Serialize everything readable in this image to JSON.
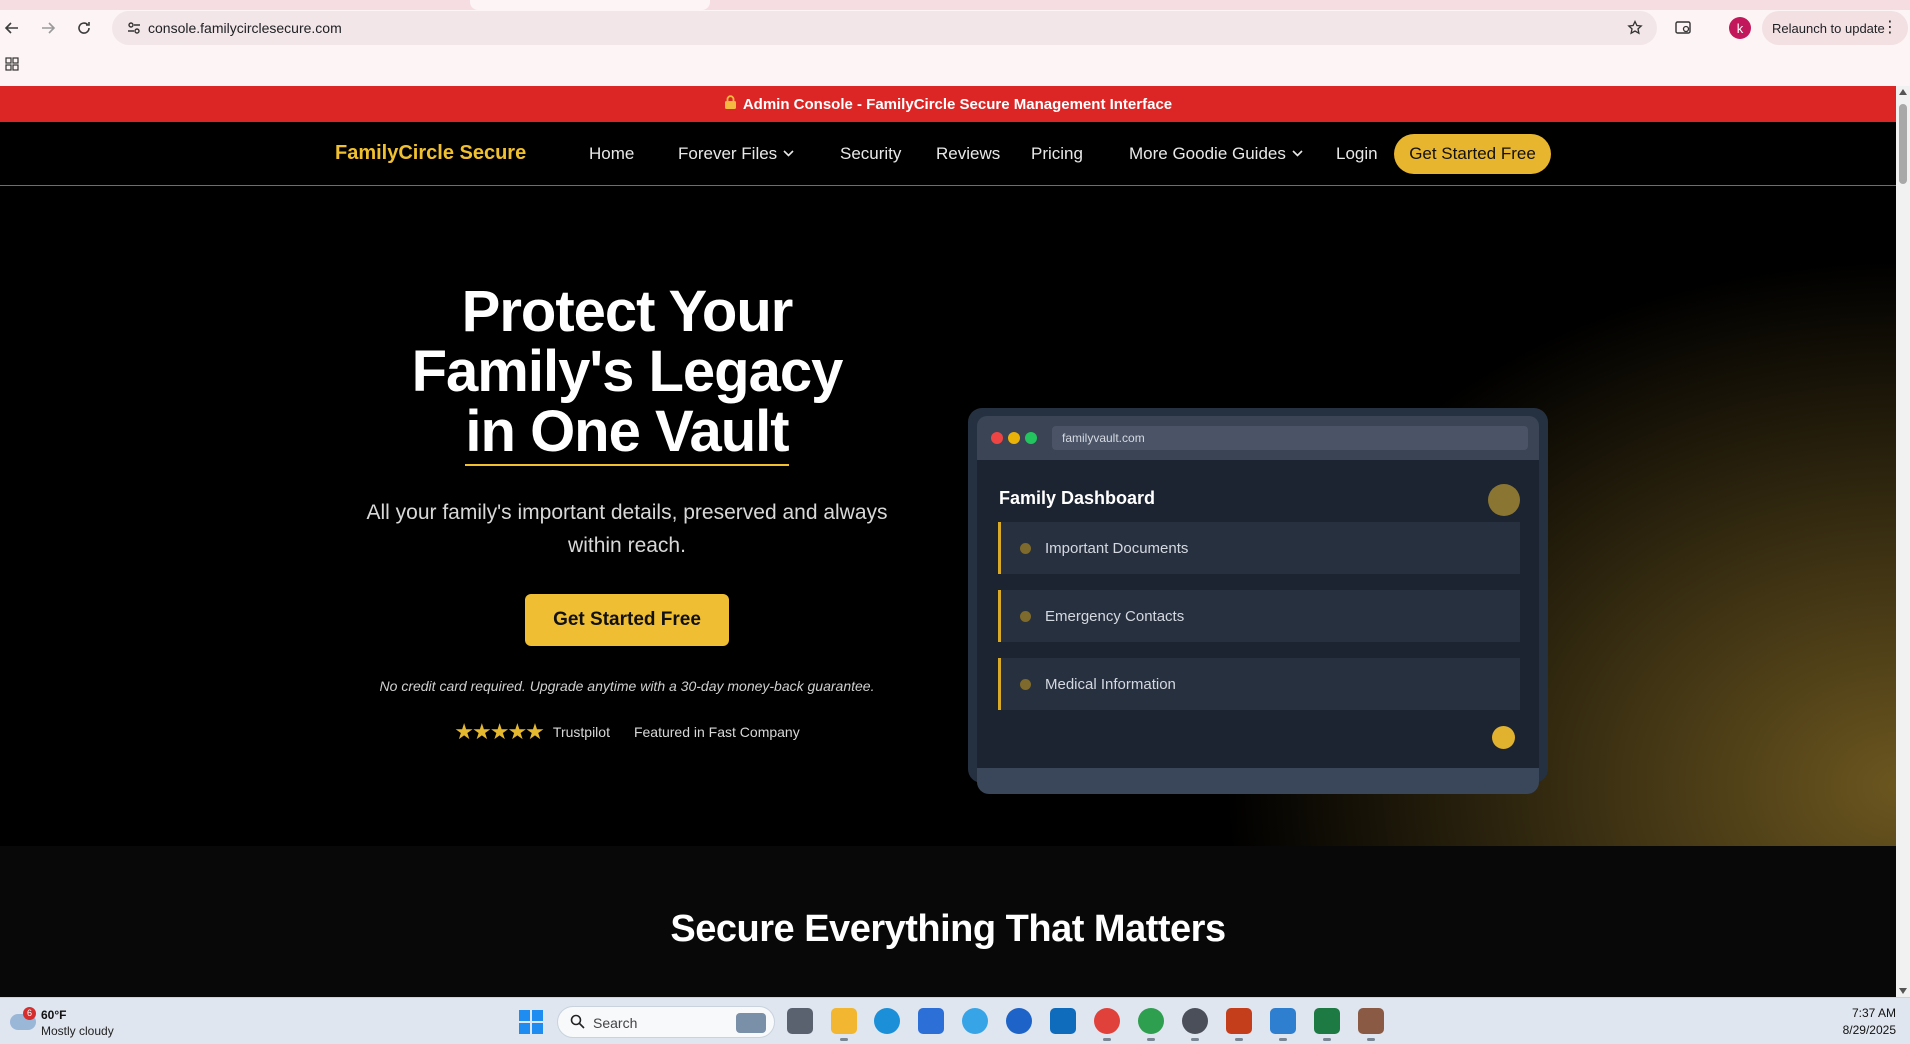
{
  "browser": {
    "url": "console.familycirclesecure.com",
    "relaunch_label": "Relaunch to update",
    "profile_initial": "k"
  },
  "banner": {
    "icon": "lock-icon",
    "text": "Admin Console - FamilyCircle Secure Management Interface",
    "color": "#dc2626"
  },
  "nav": {
    "brand": "FamilyCircle Secure",
    "items": [
      {
        "label": "Home"
      },
      {
        "label": "Forever Files"
      },
      {
        "label": "Security"
      },
      {
        "label": "Reviews"
      },
      {
        "label": "Pricing"
      },
      {
        "label": "More Goodie Guides"
      },
      {
        "label": "Login"
      }
    ],
    "cta": "Get Started Free",
    "accent": "#e8b52e"
  },
  "hero": {
    "title_line1": "Protect Your",
    "title_line2": "Family's Legacy",
    "title_line3": "in One Vault",
    "subtitle": "All your family's important details, preserved and always within reach.",
    "cta": "Get Started Free",
    "note": "No credit card required. Upgrade anytime with a 30-day money-back guarantee.",
    "rating_stars": 5,
    "rating_source": "Trustpilot",
    "featured": "Featured in Fast Company"
  },
  "mockup": {
    "url": "familyvault.com",
    "title": "Family Dashboard",
    "items": [
      {
        "label": "Important Documents"
      },
      {
        "label": "Emergency Contacts"
      },
      {
        "label": "Medical Information"
      }
    ]
  },
  "features": {
    "title": "Secure Everything That Matters"
  },
  "taskbar": {
    "weather_badge": "6",
    "temperature": "60°F",
    "condition": "Mostly cloudy",
    "search_label": "Search",
    "time": "7:37 AM",
    "date": "8/29/2025"
  }
}
